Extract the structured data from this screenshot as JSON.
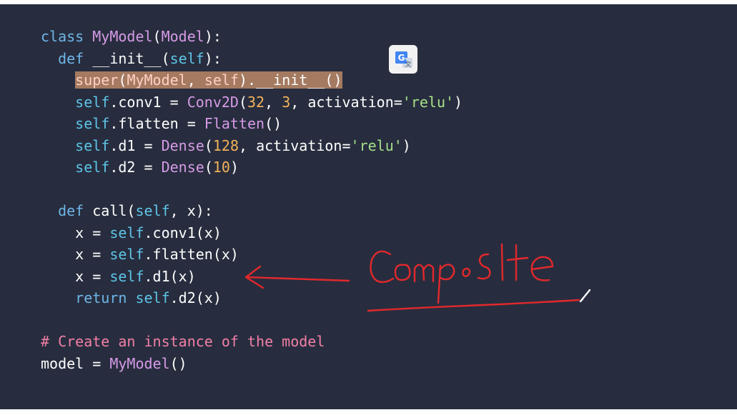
{
  "code": {
    "l1": {
      "a": "class ",
      "b": "MyModel",
      "c": "(",
      "d": "Model",
      "e": "):"
    },
    "l2": {
      "a": "  def ",
      "b": "__init__(",
      "c": "self",
      "d": "):"
    },
    "l3": {
      "pre": "    ",
      "a": "super",
      "b": "(",
      "c": "MyModel",
      "d": ", ",
      "e": "self",
      "f": ").__init__()"
    },
    "l4": {
      "pre": "    ",
      "a": "self",
      "b": ".conv1 = ",
      "c": "Conv2D",
      "d": "(",
      "e": "32",
      "f": ", ",
      "g": "3",
      "h": ", activation=",
      "i": "'relu'",
      "j": ")"
    },
    "l5": {
      "pre": "    ",
      "a": "self",
      "b": ".flatten = ",
      "c": "Flatten",
      "d": "()"
    },
    "l6": {
      "pre": "    ",
      "a": "self",
      "b": ".d1 = ",
      "c": "Dense",
      "d": "(",
      "e": "128",
      "f": ", activation=",
      "g": "'relu'",
      "h": ")"
    },
    "l7": {
      "pre": "    ",
      "a": "self",
      "b": ".d2 = ",
      "c": "Dense",
      "d": "(",
      "e": "10",
      "f": ")"
    },
    "l9": {
      "a": "  def ",
      "b": "call(",
      "c": "self",
      "d": ", x):"
    },
    "l10": {
      "a": "    x = ",
      "b": "self",
      "c": ".conv1(x)"
    },
    "l11": {
      "a": "    x = ",
      "b": "self",
      "c": ".flatten(x)"
    },
    "l12": {
      "a": "    x = ",
      "b": "self",
      "c": ".d1(x)"
    },
    "l13": {
      "a": "    return ",
      "b": "self",
      "c": ".d2(x)"
    },
    "l15": {
      "a": "# Create an instance of the model"
    },
    "l16": {
      "a": "model = ",
      "b": "MyModel",
      "c": "()"
    }
  },
  "icons": {
    "translate": "google-translate-icon",
    "pen": "pen-cursor-icon"
  },
  "annotation": {
    "text": "Composite",
    "color": "#e3282c"
  },
  "colors": {
    "background": "#272d3e",
    "keyword": "#6fb6e8",
    "class_name": "#d69ae6",
    "self": "#5ec4e8",
    "number": "#f3b25a",
    "string": "#a6e08a",
    "comment": "#f27fa6",
    "highlight": "#a47a61"
  }
}
